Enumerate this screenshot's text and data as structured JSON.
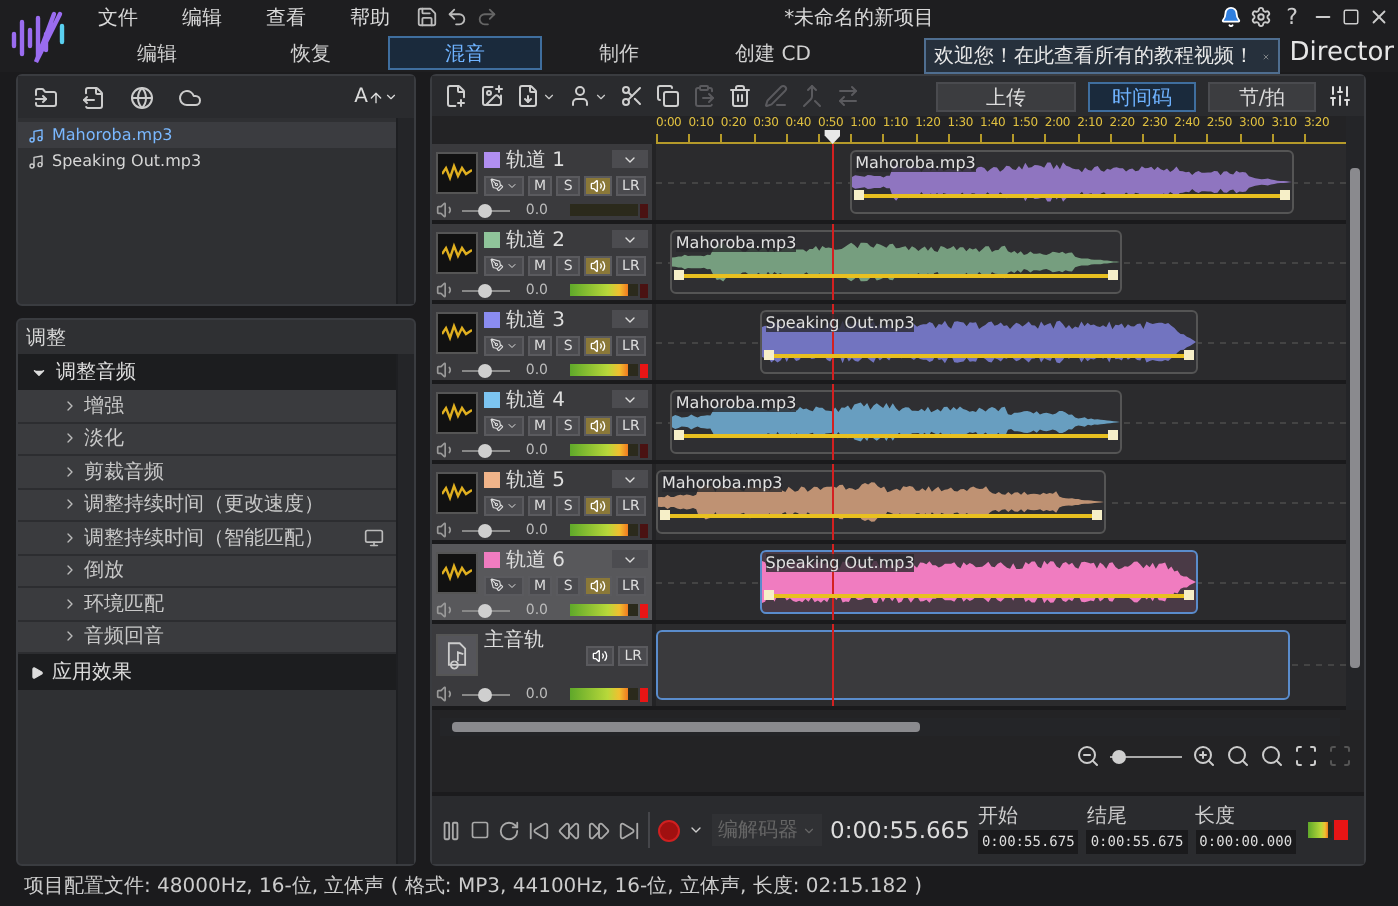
{
  "app": {
    "menu": [
      "文件",
      "编辑",
      "查看",
      "帮助"
    ],
    "title": "*未命名的新项目",
    "help": "?",
    "brand": "Director"
  },
  "tabs": [
    {
      "label": "编辑",
      "selected": false
    },
    {
      "label": "恢复",
      "selected": false
    },
    {
      "label": "混音",
      "selected": true
    },
    {
      "label": "制作",
      "selected": false
    },
    {
      "label": "创建 CD",
      "selected": false
    }
  ],
  "tooltip": {
    "text": "欢迎您！在此查看所有的教程视频！"
  },
  "library": {
    "sort": "A",
    "items": [
      {
        "name": "Mahoroba.mp3",
        "selected": true
      },
      {
        "name": "Speaking Out.mp3",
        "selected": false
      }
    ]
  },
  "adjust": {
    "title": "调整",
    "groups": [
      {
        "label": "调整音频",
        "expanded": true,
        "children": [
          {
            "label": "增强",
            "kind": "plain"
          },
          {
            "label": "淡化",
            "kind": "plain"
          },
          {
            "label": "剪裁音频",
            "kind": "plain"
          },
          {
            "label": "调整持续时间（更改速度）",
            "kind": "plain"
          },
          {
            "label": "调整持续时间（智能匹配）",
            "kind": "preview"
          },
          {
            "label": "倒放",
            "kind": "plain"
          },
          {
            "label": "环境匹配",
            "kind": "plain"
          },
          {
            "label": "音频回音",
            "kind": "plain"
          }
        ]
      },
      {
        "label": "应用效果",
        "expanded": false
      }
    ]
  },
  "toolbar": {
    "tools": [
      {
        "kind": "new",
        "disabled": false
      },
      {
        "kind": "import",
        "disabled": false
      },
      {
        "kind": "export",
        "disabled": false
      },
      {
        "kind": "person",
        "disabled": false
      },
      {
        "kind": "cut",
        "disabled": false
      },
      {
        "kind": "copy",
        "disabled": false
      },
      {
        "kind": "paste",
        "disabled": true
      },
      {
        "kind": "delete",
        "disabled": false
      },
      {
        "kind": "edit",
        "disabled": true
      },
      {
        "kind": "merge",
        "disabled": true
      },
      {
        "kind": "split",
        "disabled": true
      }
    ],
    "upload": "上传",
    "modes": [
      {
        "label": "时间码",
        "selected": true
      },
      {
        "label": "节/拍",
        "selected": false
      }
    ]
  },
  "ruler": {
    "labels": [
      "0:00",
      "0:10",
      "0:20",
      "0:30",
      "0:40",
      "0:50",
      "1:00",
      "1:10",
      "1:20",
      "1:30",
      "1:40",
      "1:50",
      "2:00",
      "2:10",
      "2:20",
      "2:30",
      "2:40",
      "2:50",
      "3:00",
      "3:10",
      "3:20"
    ],
    "playhead": {
      "level": 0.256
    }
  },
  "tracks": [
    {
      "name": "轨道 1",
      "color": "#b08ef0",
      "selected": false,
      "audible": true,
      "mute": "M",
      "solo": "S",
      "pan": "LR",
      "volume": {
        "level": 0.45
      },
      "gain": "0.0",
      "meter": {
        "level": 0.0
      },
      "clipped": false,
      "clip": {
        "name": "Mahoroba.mp3",
        "selected": false
      }
    },
    {
      "name": "轨道 2",
      "color": "#8fc49a",
      "selected": false,
      "audible": true,
      "mute": "M",
      "solo": "S",
      "pan": "LR",
      "volume": {
        "level": 0.45
      },
      "gain": "0.0",
      "meter": {
        "level": 0.85
      },
      "clipped": false,
      "clip": {
        "name": "Mahoroba.mp3",
        "selected": false
      }
    },
    {
      "name": "轨道 3",
      "color": "#8a8cf0",
      "selected": false,
      "audible": true,
      "mute": "M",
      "solo": "S",
      "pan": "LR",
      "volume": {
        "level": 0.45
      },
      "gain": "0.0",
      "meter": {
        "level": 0.85
      },
      "clipped": true,
      "clip": {
        "name": "Speaking Out.mp3",
        "selected": false
      }
    },
    {
      "name": "轨道 4",
      "color": "#7cc4f0",
      "selected": false,
      "audible": true,
      "mute": "M",
      "solo": "S",
      "pan": "LR",
      "volume": {
        "level": 0.45
      },
      "gain": "0.0",
      "meter": {
        "level": 0.85
      },
      "clipped": false,
      "clip": {
        "name": "Mahoroba.mp3",
        "selected": false
      }
    },
    {
      "name": "轨道 5",
      "color": "#f0b48a",
      "selected": false,
      "audible": true,
      "mute": "M",
      "solo": "S",
      "pan": "LR",
      "volume": {
        "level": 0.45
      },
      "gain": "0.0",
      "meter": {
        "level": 0.85
      },
      "clipped": false,
      "clip": {
        "name": "Mahoroba.mp3",
        "selected": false
      }
    },
    {
      "name": "轨道 6",
      "color": "#f07cc0",
      "selected": true,
      "audible": true,
      "mute": "M",
      "solo": "S",
      "pan": "LR",
      "volume": {
        "level": 0.45
      },
      "gain": "0.0",
      "meter": {
        "level": 0.85
      },
      "clipped": true,
      "clip": {
        "name": "Speaking Out.mp3",
        "selected": true
      }
    }
  ],
  "master": {
    "name": "主音轨",
    "audible": true,
    "pan": "LR",
    "volume": {
      "level": 0.45
    },
    "gain": "0.0",
    "meter": {
      "level": 0.85
    },
    "clipped": true
  },
  "zoom": {
    "level": 0.1
  },
  "transport": {
    "codec": {
      "label": "编解码器",
      "disabled": true
    },
    "time": "0:00:55.665",
    "fields": [
      {
        "label": "开始",
        "value": "0:00:55.675"
      },
      {
        "label": "结尾",
        "value": "0:00:55.675"
      },
      {
        "label": "长度",
        "value": "0:00:00.000"
      }
    ]
  },
  "status_bar": "项目配置文件: 48000Hz, 16-位, 立体声 ( 格式: MP3, 44100Hz, 16-位, 立体声, 长度: 02:15.182 )"
}
